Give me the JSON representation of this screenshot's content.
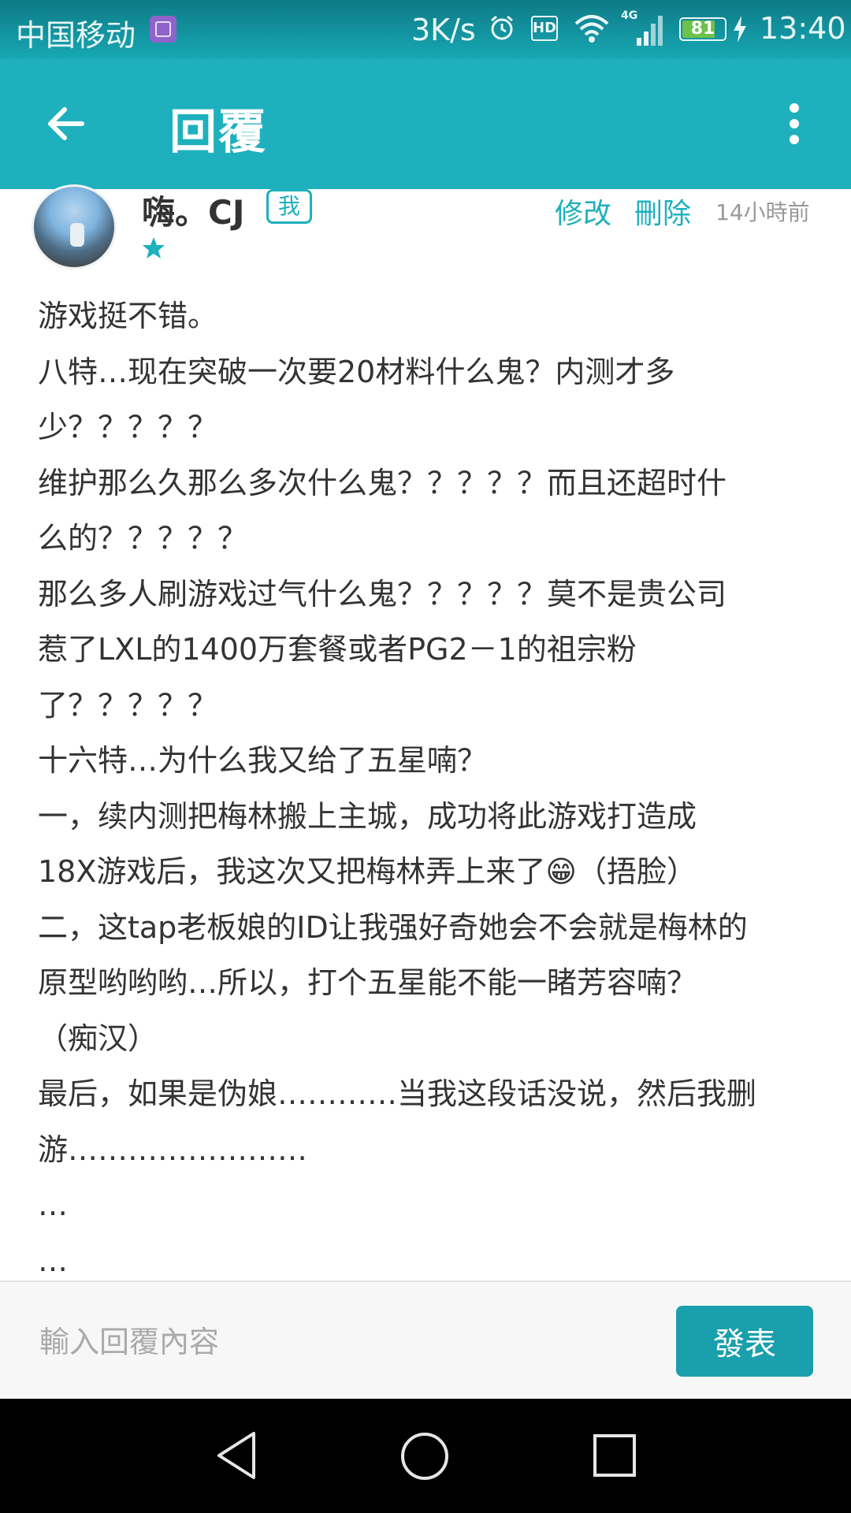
{
  "status_bar": {
    "carrier": "中国移动",
    "speed": "3K/s",
    "hd": "HD",
    "network": "4G",
    "battery": "81",
    "battery_level": 0.81,
    "time": "13:40"
  },
  "toolbar": {
    "title": "回覆"
  },
  "post": {
    "username": "嗨。CJ",
    "me_badge": "我",
    "stars": 1,
    "edit_label": "修改",
    "delete_label": "刪除",
    "timestamp": "14小時前",
    "lines": [
      "游戏挺不错。",
      "八特…现在突破一次要20材料什么鬼？内测才多",
      "少？？？？？",
      "维护那么久那么多次什么鬼？？？？？而且还超时什",
      "么的？？？？？",
      "那么多人刷游戏过气什么鬼？？？？？莫不是贵公司",
      "惹了LXL的1400万套餐或者PG2－1的祖宗粉",
      "了？？？？？",
      "十六特…为什么我又给了五星喃？",
      "一，续内测把梅林搬上主城，成功将此游戏打造成",
      "18X游戏后，我这次又把梅林弄上来了😁（捂脸）",
      "二，这tap老板娘的ID让我强好奇她会不会就是梅林的",
      "原型哟哟哟…所以，打个五星能不能一睹芳容喃？",
      "（痴汉）",
      "最后，如果是伪娘…………当我这段话没说，然后我删",
      "游……………………",
      "…",
      "…"
    ]
  },
  "reply": {
    "placeholder": "輸入回覆內容",
    "send_label": "發表"
  },
  "colors": {
    "accent": "#1eb0bd",
    "send_button": "#1a9fac"
  }
}
